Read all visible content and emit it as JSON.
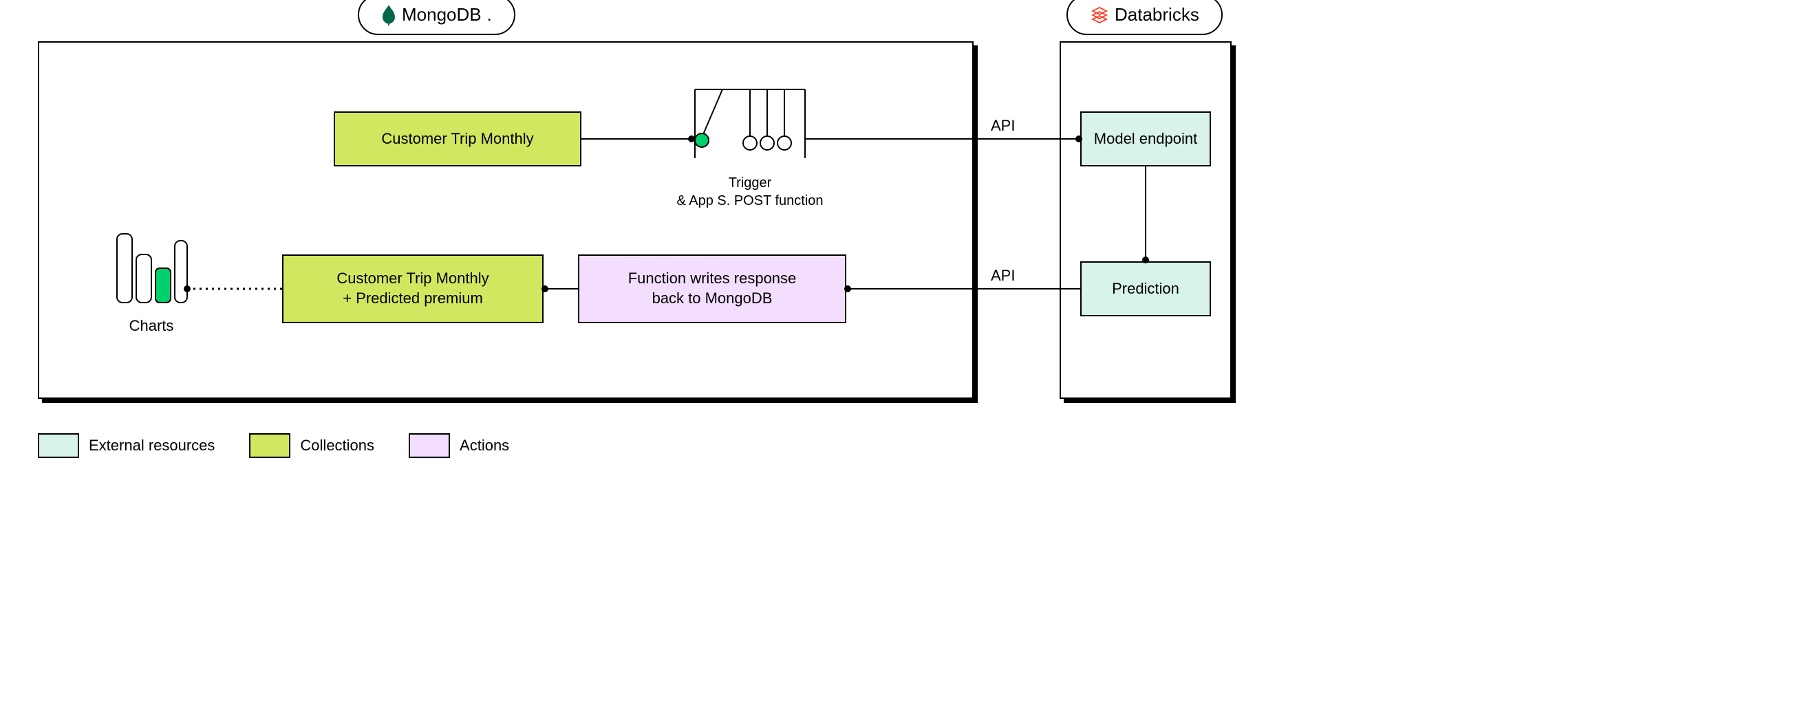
{
  "containers": {
    "mongo_label": "MongoDB",
    "databricks_label": "Databricks"
  },
  "nodes": {
    "customer_trip_monthly": "Customer Trip Monthly",
    "customer_trip_monthly_predicted": "Customer Trip Monthly\n+ Predicted premium",
    "function_writes_back": "Function writes response\nback to MongoDB",
    "model_endpoint": "Model endpoint",
    "prediction": "Prediction"
  },
  "trigger": {
    "label_line1": "Trigger",
    "label_line2": "& App S. POST function"
  },
  "charts": {
    "label": "Charts"
  },
  "edges": {
    "api_top": "API",
    "api_bottom": "API"
  },
  "legend": {
    "external": "External resources",
    "collections": "Collections",
    "actions": "Actions"
  },
  "colors": {
    "collection": "#d3e660",
    "action": "#f3deff",
    "external": "#d7f3eb",
    "accent_green": "#00d16c",
    "databricks_red": "#ff3621"
  }
}
